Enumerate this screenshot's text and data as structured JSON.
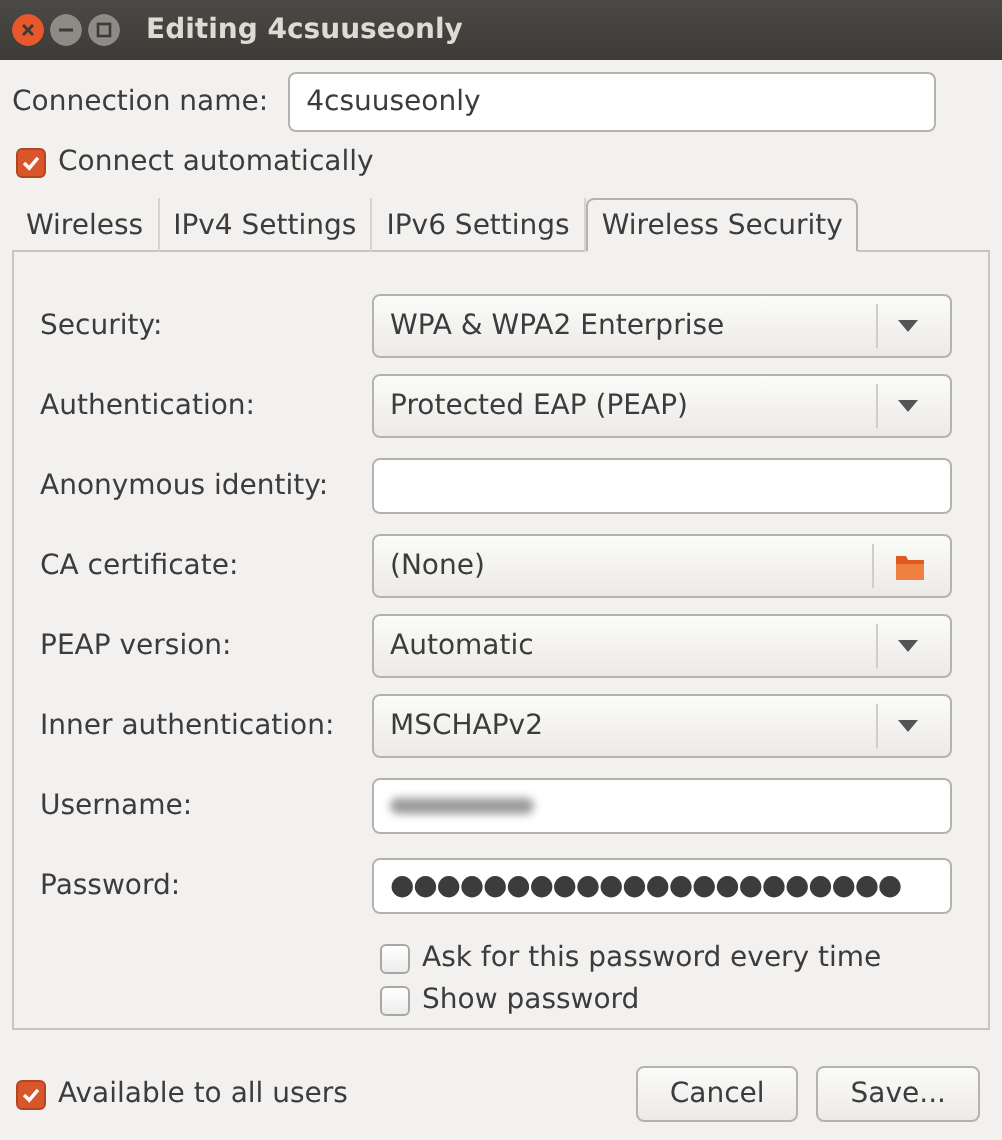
{
  "window": {
    "title": "Editing 4csuuseonly"
  },
  "connection_name": {
    "label": "Connection name:",
    "value": "4csuuseonly"
  },
  "connect_automatically": {
    "label": "Connect automatically",
    "checked": true
  },
  "tabs": [
    {
      "label": "Wireless",
      "selected": false
    },
    {
      "label": "IPv4 Settings",
      "selected": false
    },
    {
      "label": "IPv6 Settings",
      "selected": false
    },
    {
      "label": "Wireless Security",
      "selected": true
    }
  ],
  "fields": [
    {
      "kind": "dropdown",
      "label": "Security:",
      "value": "WPA & WPA2 Enterprise"
    },
    {
      "kind": "dropdown",
      "label": "Authentication:",
      "value": "Protected EAP (PEAP)"
    },
    {
      "kind": "entry",
      "label": "Anonymous identity:"
    },
    {
      "kind": "file",
      "label": "CA certificate:",
      "value": "(None)"
    },
    {
      "kind": "dropdown",
      "label": "PEAP version:",
      "value": "Automatic"
    },
    {
      "kind": "dropdown",
      "label": "Inner authentication:",
      "value": "MSCHAPv2"
    },
    {
      "kind": "blurred",
      "label": "Username:"
    },
    {
      "kind": "entry",
      "label": "Password:",
      "value": "●●●●●●●●●●●●●●●●●●●●●●"
    }
  ],
  "options": [
    {
      "label": "Ask for this password every time",
      "checked": false
    },
    {
      "label": "Show password",
      "checked": false
    }
  ],
  "available_to_all_users": {
    "label": "Available to all users",
    "checked": true
  },
  "buttons": [
    "Cancel",
    "Save..."
  ]
}
